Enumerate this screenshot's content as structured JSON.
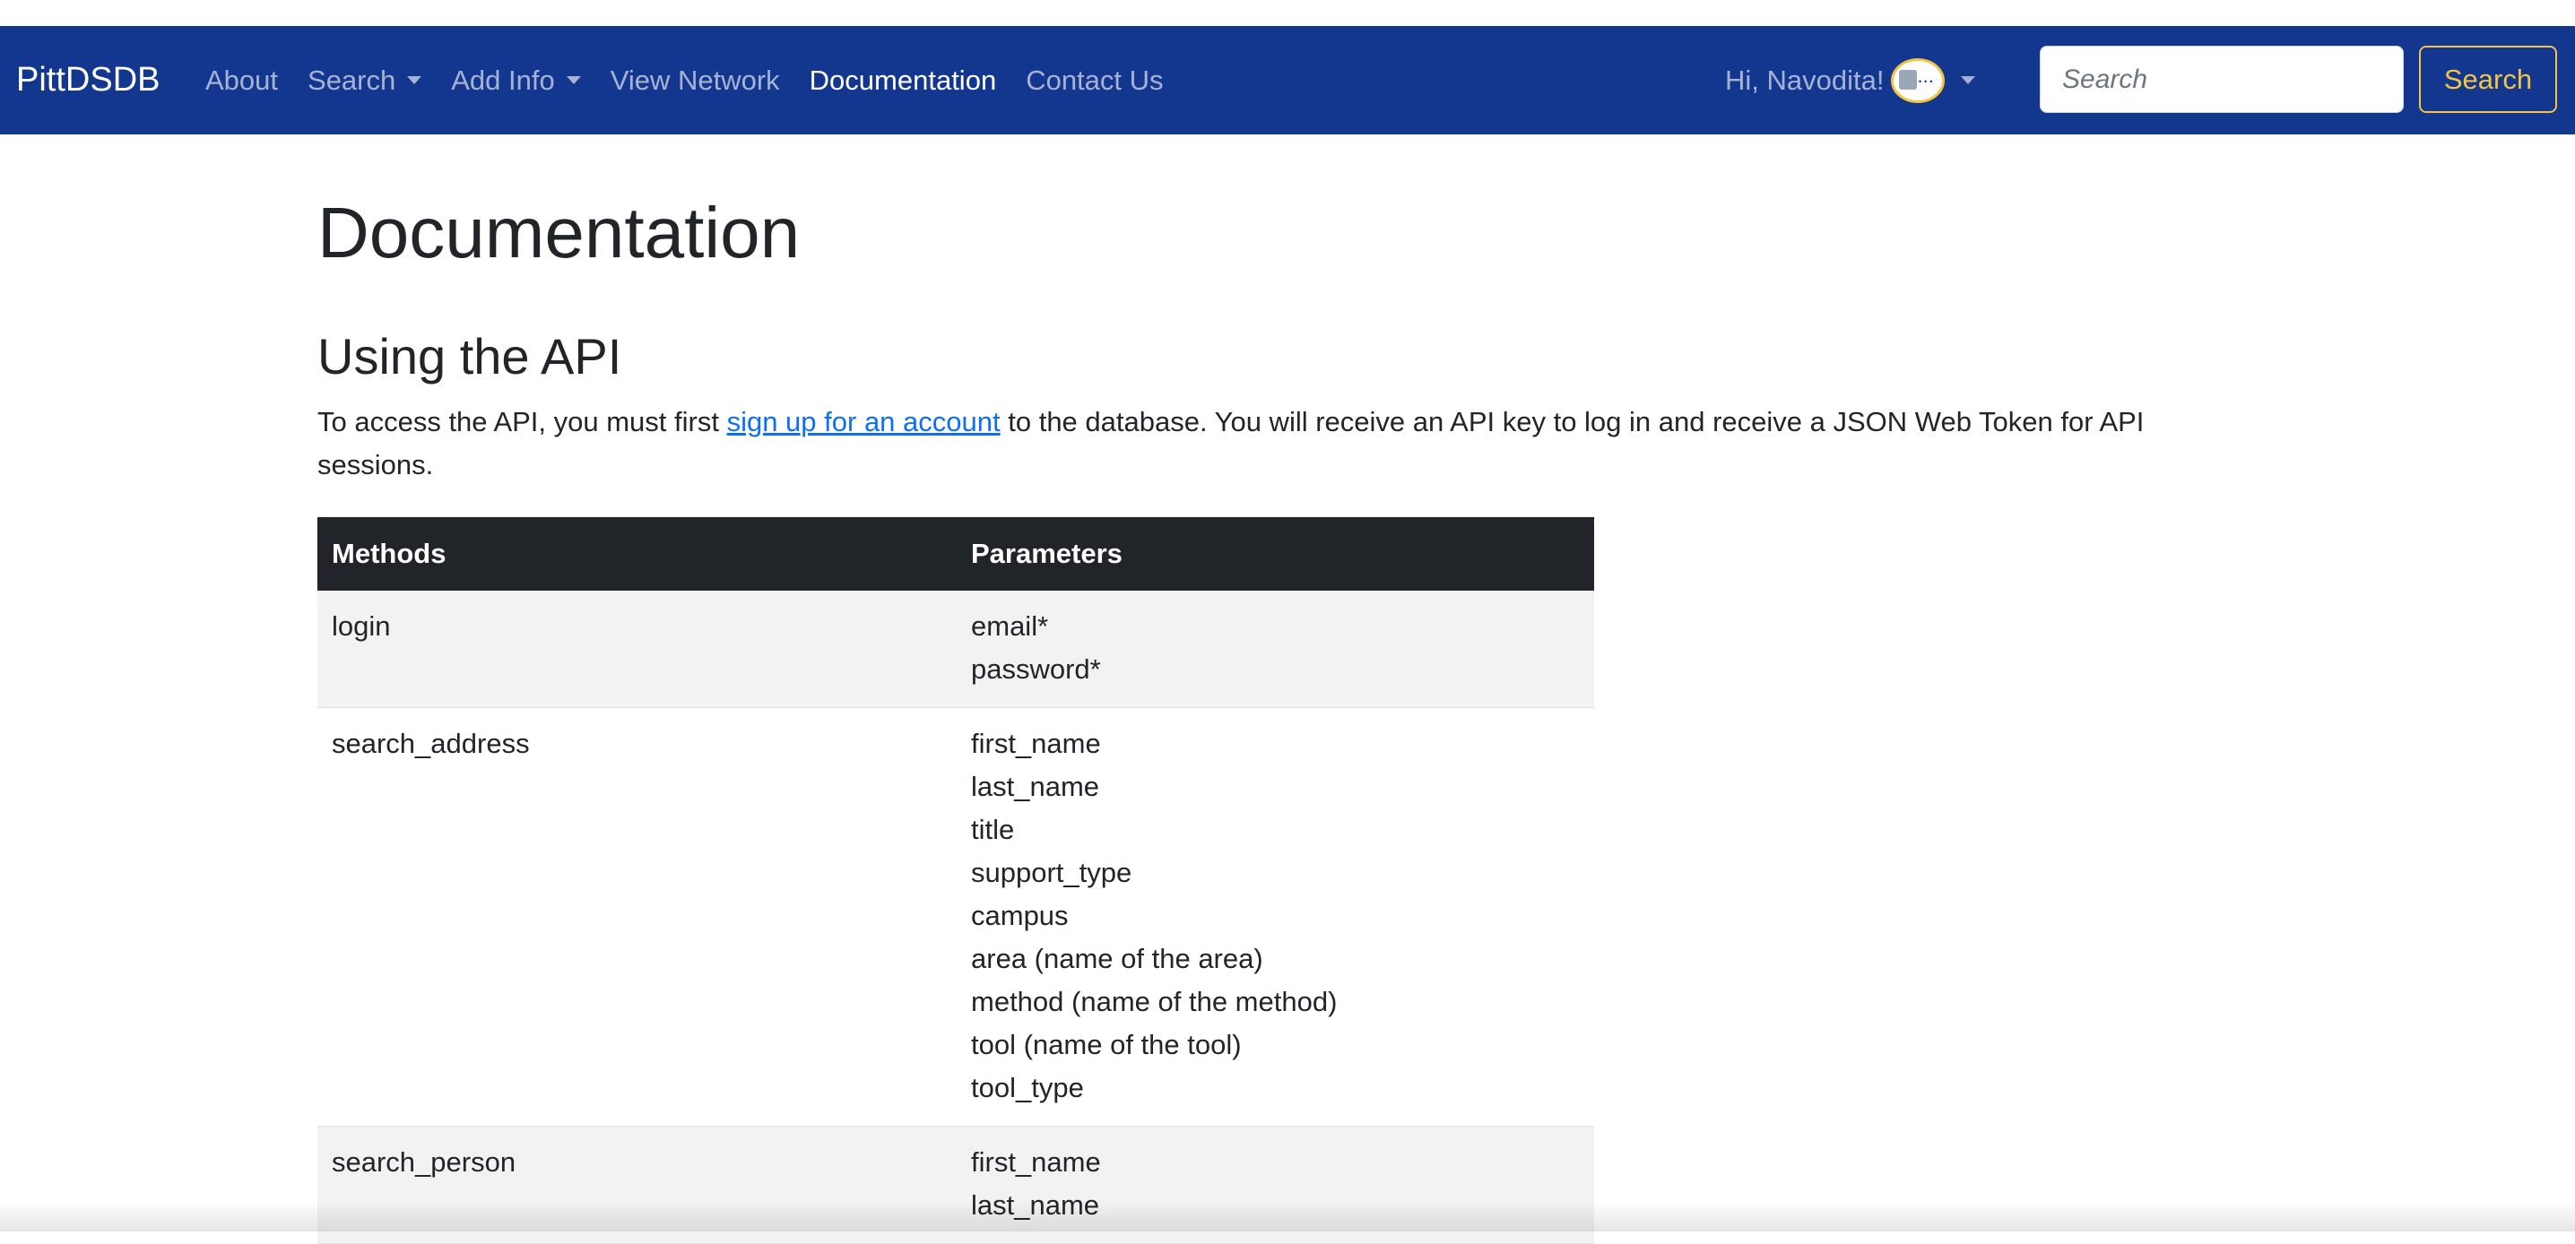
{
  "navbar": {
    "brand": "PittDSDB",
    "links": [
      {
        "label": "About"
      },
      {
        "label": "Search"
      },
      {
        "label": "Add Info"
      },
      {
        "label": "View Network"
      },
      {
        "label": "Documentation"
      },
      {
        "label": "Contact Us"
      }
    ],
    "user_greeting": "Hi, Navodita!",
    "search_placeholder": "Search",
    "search_button": "Search"
  },
  "main": {
    "page_title": "Documentation",
    "section_title": "Using the API",
    "intro_before_link": "To access the API, you must first ",
    "intro_link": "sign up for an account",
    "intro_after_link": " to the database. You will receive an API key to log in and receive a JSON Web Token for API sessions.",
    "table": {
      "headers": [
        "Methods",
        "Parameters"
      ],
      "rows": [
        {
          "method": "login",
          "params": [
            "email*",
            "password*"
          ]
        },
        {
          "method": "search_address",
          "params": [
            "first_name",
            "last_name",
            "title",
            "support_type",
            "campus",
            "area (name of the area)",
            "method (name of the method)",
            "tool (name of the tool)",
            "tool_type"
          ]
        },
        {
          "method": "search_person",
          "params": [
            "first_name",
            "last_name"
          ]
        }
      ]
    }
  },
  "colors": {
    "navbar_bg": "#13368f",
    "accent_yellow": "#f4c542",
    "link_blue": "#0d6efd",
    "table_header_bg": "#212529"
  }
}
